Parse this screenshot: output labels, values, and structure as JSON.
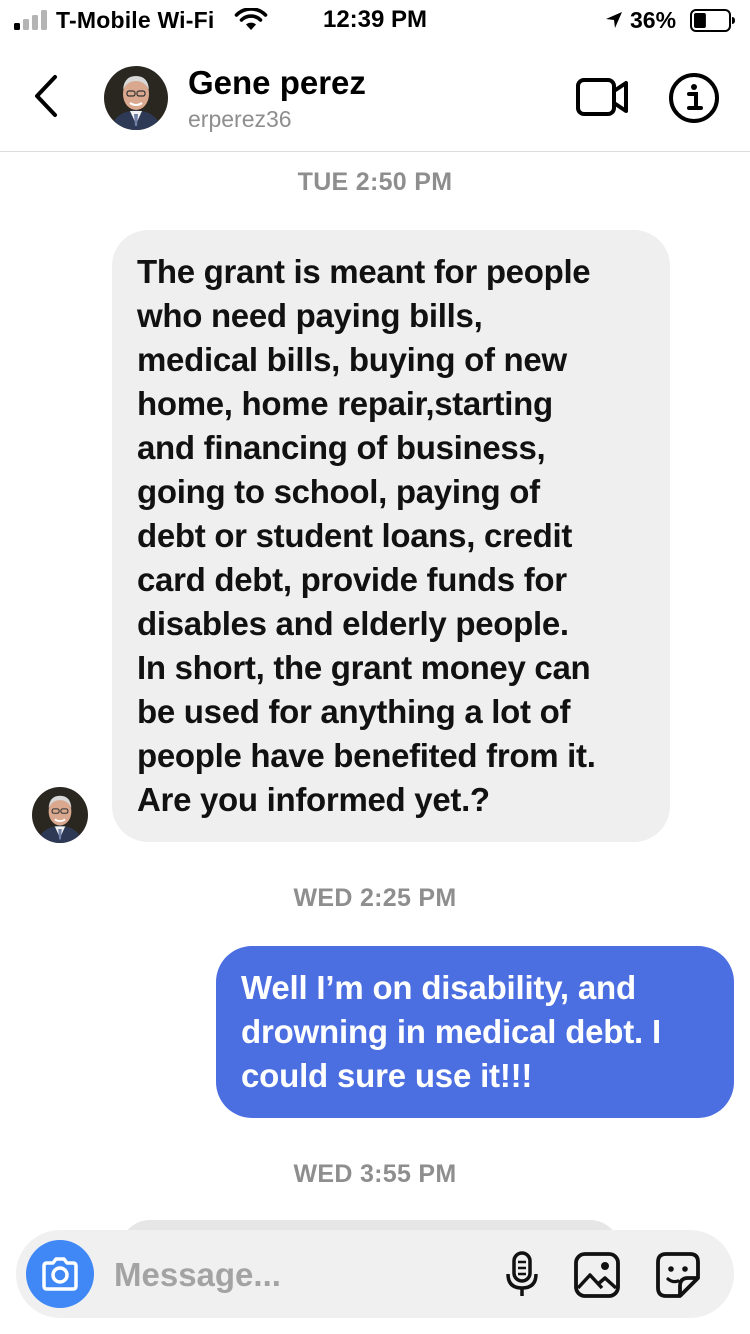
{
  "status_bar": {
    "carrier": "T-Mobile Wi-Fi",
    "time": "12:39 PM",
    "battery_percent": "36%",
    "battery_level": 0.36,
    "icons": [
      "signal-icon",
      "wifi-icon",
      "location-arrow-icon",
      "battery-icon"
    ]
  },
  "header": {
    "contact_name": "Gene perez",
    "contact_handle": "erperez36",
    "icons": [
      "back-chevron-icon",
      "avatar",
      "video-call-icon",
      "info-icon"
    ]
  },
  "thread": {
    "timestamps": [
      "TUE 2:50 PM",
      "WED 2:25 PM",
      "WED 3:55 PM"
    ],
    "messages": [
      {
        "direction": "incoming",
        "text": "The grant is meant for people\nwho need paying bills,\nmedical bills, buying of new\nhome, home repair,starting\nand financing of business,\ngoing to school, paying of\ndebt or student loans, credit\ncard debt, provide funds for\ndisables and elderly people.\nIn short, the grant money can\nbe used for anything a lot of\npeople have benefited from it.\nAre you informed yet.?"
      },
      {
        "direction": "outgoing",
        "text": "Well I’m on disability, and\ndrowning in medical debt.  I\ncould sure use it!!!"
      }
    ]
  },
  "composer": {
    "placeholder": "Message...",
    "icons": [
      "camera-icon",
      "microphone-icon",
      "gallery-icon",
      "sticker-icon"
    ]
  },
  "colors": {
    "outgoing_bubble": "#4b6ee1",
    "incoming_bubble": "#efefef",
    "camera_button": "#3f88f5",
    "secondary_text": "#8e8e8e"
  }
}
